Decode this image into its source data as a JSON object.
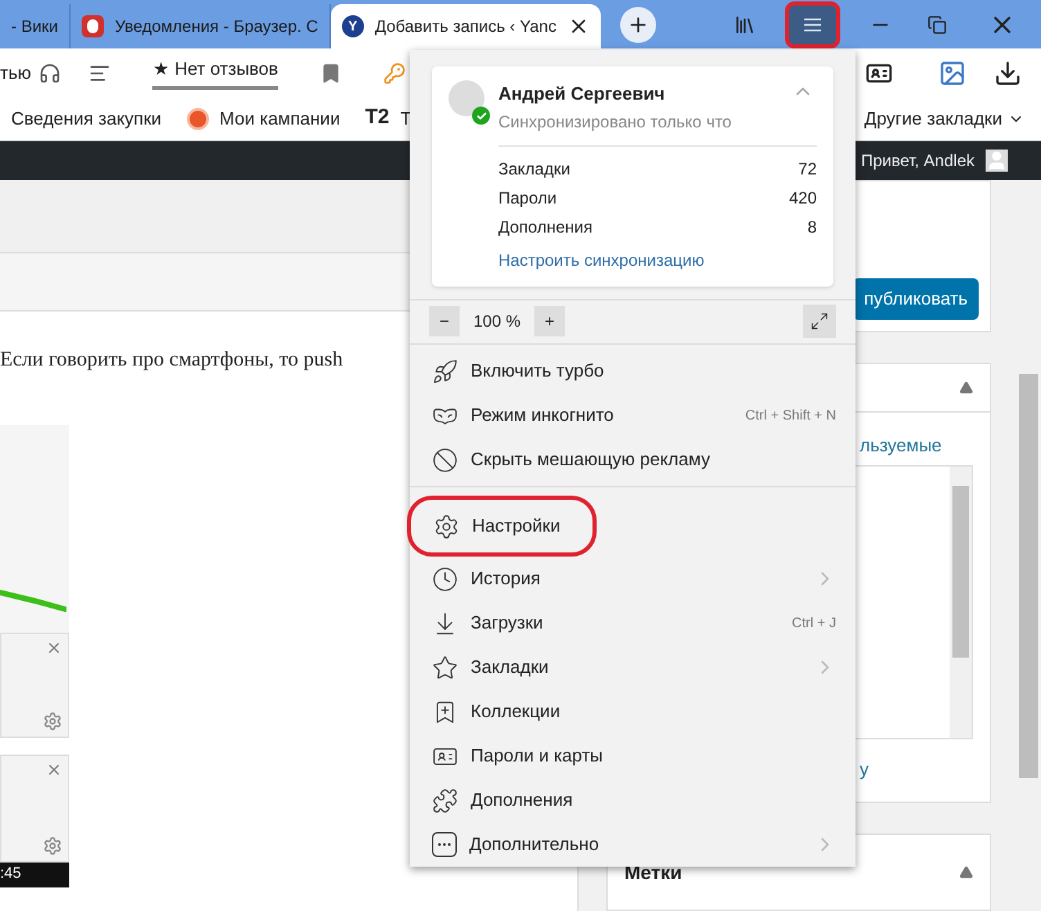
{
  "tabs": [
    {
      "title": "- Вики",
      "selected": false
    },
    {
      "title": "Уведомления - Браузер. С",
      "selected": false
    },
    {
      "title": "Добавить запись ‹ Yanc",
      "selected": true,
      "favicon_text": "Y"
    }
  ],
  "menu_button": {
    "highlighted": true
  },
  "toolbar": {
    "partial_label": "тью",
    "review_label": "★ Нет отзывов"
  },
  "bookmarks": [
    {
      "label": "Сведения закупки"
    },
    {
      "label": "Мои кампании"
    },
    {
      "label": "Т",
      "logo_text": "T2"
    }
  ],
  "other_bookmarks": "Другие закладки",
  "admin_bar": {
    "greeting": "Привет, Andlek"
  },
  "editor": {
    "text": "Если говорить про смартфоны, то push"
  },
  "taskbar_time": ":45",
  "sidebar": {
    "publish_button": "публиковать",
    "category_link": "льзуемые",
    "category_link_2": "у",
    "tags_title": "Метки"
  },
  "menu": {
    "profile": {
      "name": "Андрей Сергеевич",
      "status": "Синхронизировано только что",
      "expanded": true
    },
    "sync_stats": [
      {
        "label": "Закладки",
        "value": "72"
      },
      {
        "label": "Пароли",
        "value": "420"
      },
      {
        "label": "Дополнения",
        "value": "8"
      }
    ],
    "sync_link": "Настроить синхронизацию",
    "zoom": {
      "minus": "−",
      "value": "100 %",
      "plus": "+"
    },
    "groups": [
      [
        {
          "label": "Включить турбо",
          "submenu": false,
          "highlighted": false
        },
        {
          "label": "Режим инкогнито",
          "shortcut": "Ctrl + Shift + N",
          "submenu": false,
          "highlighted": false
        },
        {
          "label": "Скрыть мешающую рекламу",
          "submenu": false,
          "highlighted": false
        }
      ],
      [
        {
          "label": "Настройки",
          "submenu": false,
          "highlighted": true
        },
        {
          "label": "История",
          "submenu": true,
          "highlighted": false
        },
        {
          "label": "Загрузки",
          "shortcut": "Ctrl + J",
          "submenu": false,
          "highlighted": false
        },
        {
          "label": "Закладки",
          "submenu": true,
          "highlighted": false
        },
        {
          "label": "Коллекции",
          "submenu": false,
          "highlighted": false
        },
        {
          "label": "Пароли и карты",
          "submenu": false,
          "highlighted": false
        },
        {
          "label": "Дополнения",
          "submenu": false,
          "highlighted": false
        },
        {
          "label": "Дополнительно",
          "submenu": true,
          "highlighted": false
        }
      ]
    ]
  }
}
